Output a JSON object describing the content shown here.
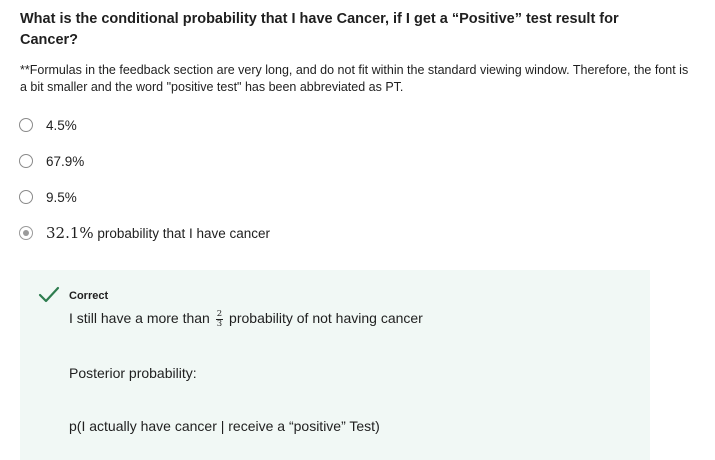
{
  "question": {
    "title": "What is the conditional probability that I have Cancer, if I get a “Positive” test result for Cancer?",
    "note": "**Formulas in the feedback section are very long, and do not fit within the standard viewing window. Therefore, the font is a bit smaller and the word \"positive test\" has been abbreviated as PT."
  },
  "options": [
    {
      "label": "4.5%",
      "selected": false
    },
    {
      "label": "67.9%",
      "selected": false
    },
    {
      "label": "9.5%",
      "selected": false
    },
    {
      "value": "32.1%",
      "text": " probability that I have cancer",
      "selected": true
    }
  ],
  "feedback": {
    "status": "Correct",
    "status_color": "#2e7d4f",
    "line1_before": "I still have a more than ",
    "fraction": {
      "numerator": "2",
      "denominator": "3"
    },
    "line1_after": " probability of not having cancer",
    "line2": "Posterior probability:",
    "line3": "p(I actually have cancer | receive a “positive” Test)"
  }
}
